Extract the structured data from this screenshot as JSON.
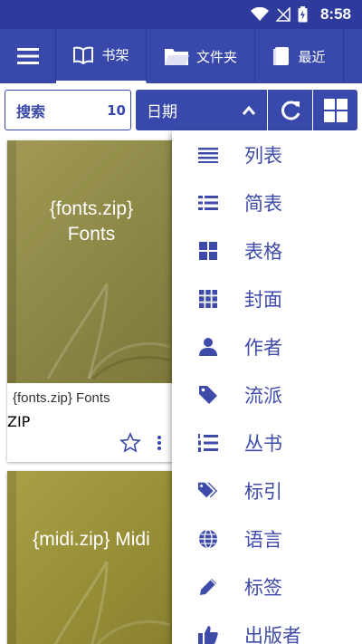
{
  "status_bar": {
    "time": "8:58"
  },
  "tabs": [
    {
      "label": "书架",
      "icon": "book-open-icon",
      "active": true
    },
    {
      "label": "文件夹",
      "icon": "folder-icon",
      "active": false
    },
    {
      "label": "最近",
      "icon": "recent-book-icon",
      "active": false
    }
  ],
  "toolbar": {
    "search_label": "搜索",
    "search_count": "10",
    "sort_label": "日期",
    "accent": "#3949ab"
  },
  "books": [
    {
      "cover_title_line1": "{fonts.zip}",
      "cover_title_line2": "Fonts",
      "title": "{fonts.zip} Fonts",
      "format": "ZIP"
    },
    {
      "cover_title_line1": "{midi.zip} Midi",
      "cover_title_line2": ""
    }
  ],
  "view_menu": {
    "items": [
      {
        "label": "列表",
        "icon": "list-icon"
      },
      {
        "label": "简表",
        "icon": "compact-list-icon"
      },
      {
        "label": "表格",
        "icon": "grid-icon"
      },
      {
        "label": "封面",
        "icon": "cover-grid-icon"
      },
      {
        "label": "作者",
        "icon": "person-icon"
      },
      {
        "label": "流派",
        "icon": "tag-icon"
      },
      {
        "label": "丛书",
        "icon": "numbered-list-icon"
      },
      {
        "label": "标引",
        "icon": "tags-icon"
      },
      {
        "label": "语言",
        "icon": "globe-icon"
      },
      {
        "label": "标签",
        "icon": "pencil-icon"
      },
      {
        "label": "出版者",
        "icon": "thumbs-up-icon"
      }
    ]
  }
}
